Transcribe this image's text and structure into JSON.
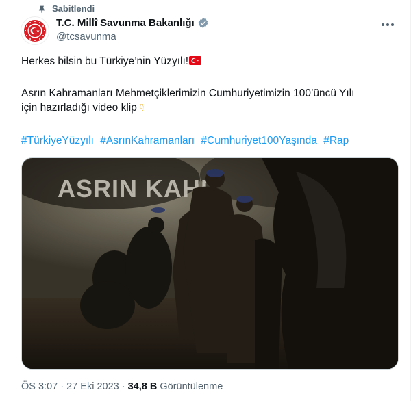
{
  "pinned_label": "Sabitlendi",
  "author": {
    "display_name": "T.C. Millî Savunma Bakanlığı",
    "handle": "@tcsavunma"
  },
  "tweet": {
    "line1": "Herkes bilsin bu  Türkiye’nin Yüzyılı!",
    "line2": "Asrın Kahramanları Mehmetçiklerimizin Cumhuriyetimizin 100’üncü Yılı",
    "line3": "için hazırladığı video klip",
    "hashtags": [
      "#TürkiyeYüzyılı",
      "#AsrınKahramanları",
      "#Cumhuriyet100Yaşında",
      "#Rap"
    ]
  },
  "media": {
    "overlay_text": "ASRIN KAHR"
  },
  "meta": {
    "time": "ÖS 3:07",
    "separator": "·",
    "date": "27 Eki 2023",
    "views_count": "34,8 B",
    "views_label": "Görüntülenme"
  },
  "colors": {
    "link": "#1d9bf0",
    "verified": "#829aab",
    "flag": "#e30a17",
    "emoji": "#f2b631"
  },
  "icons": [
    "pin-icon",
    "verified-badge-icon",
    "more-options-icon",
    "turkish-flag-icon",
    "backhand-index-pointing-down-icon"
  ]
}
